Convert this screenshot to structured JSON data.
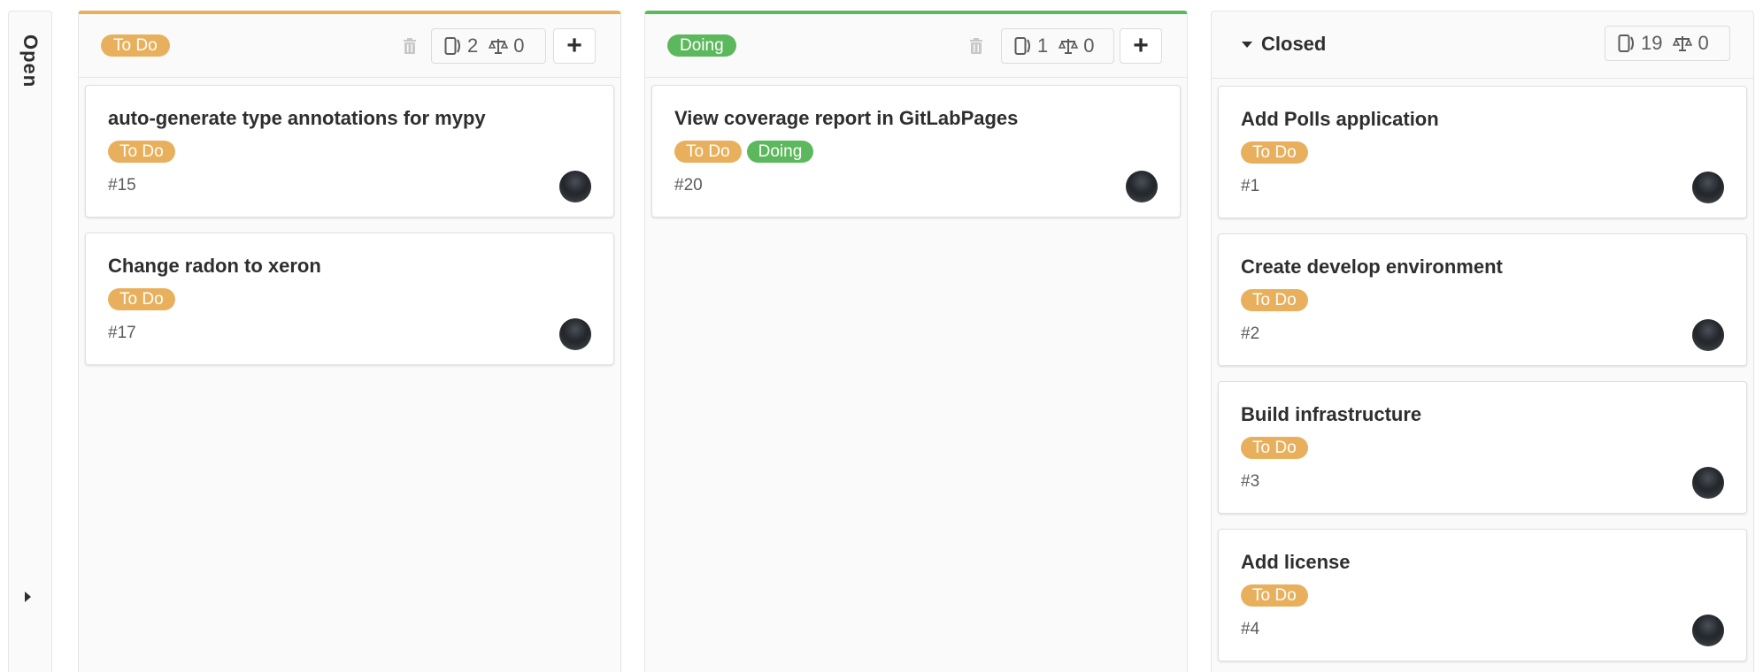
{
  "open_list": {
    "title": "Open"
  },
  "colors": {
    "todo": "#e8b05c",
    "doing": "#5cb85c"
  },
  "lists": {
    "todo": {
      "label": "To Do",
      "issue_count": "2",
      "weight": "0",
      "cards": [
        {
          "title": "auto-generate type annotations for mypy",
          "labels": [
            "To Do"
          ],
          "ref": "#15"
        },
        {
          "title": "Change radon to xeron",
          "labels": [
            "To Do"
          ],
          "ref": "#17"
        }
      ]
    },
    "doing": {
      "label": "Doing",
      "issue_count": "1",
      "weight": "0",
      "cards": [
        {
          "title": "View coverage report in GitLabPages",
          "labels": [
            "To Do",
            "Doing"
          ],
          "ref": "#20"
        }
      ]
    },
    "closed": {
      "title": "Closed",
      "issue_count": "19",
      "weight": "0",
      "cards": [
        {
          "title": "Add Polls application",
          "labels": [
            "To Do"
          ],
          "ref": "#1"
        },
        {
          "title": "Create develop environment",
          "labels": [
            "To Do"
          ],
          "ref": "#2"
        },
        {
          "title": "Build infrastructure",
          "labels": [
            "To Do"
          ],
          "ref": "#3"
        },
        {
          "title": "Add license",
          "labels": [
            "To Do"
          ],
          "ref": "#4"
        }
      ]
    }
  },
  "icons": {
    "issues": "issues-icon",
    "weight": "weight-icon",
    "trash": "trash-icon",
    "add": "plus-icon",
    "collapse": "caret-down-icon",
    "expand": "caret-right-icon"
  }
}
